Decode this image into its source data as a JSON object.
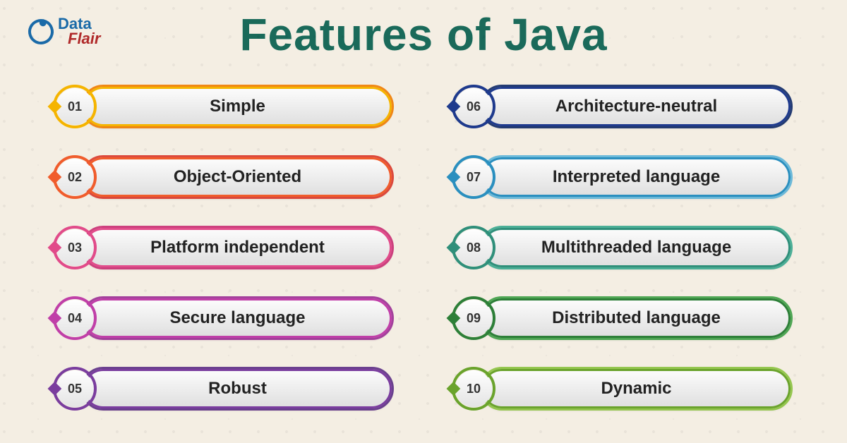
{
  "logo": {
    "line1": "Data",
    "line2": "Flair"
  },
  "title": "Features of Java",
  "features": [
    {
      "num": "01",
      "label": "Simple",
      "color": "c1"
    },
    {
      "num": "02",
      "label": "Object-Oriented",
      "color": "c2"
    },
    {
      "num": "03",
      "label": "Platform independent",
      "color": "c3"
    },
    {
      "num": "04",
      "label": "Secure language",
      "color": "c4"
    },
    {
      "num": "05",
      "label": "Robust",
      "color": "c5"
    },
    {
      "num": "06",
      "label": "Architecture-neutral",
      "color": "c6"
    },
    {
      "num": "07",
      "label": "Interpreted language",
      "color": "c7"
    },
    {
      "num": "08",
      "label": "Multithreaded language",
      "color": "c8"
    },
    {
      "num": "09",
      "label": "Distributed language",
      "color": "c9"
    },
    {
      "num": "10",
      "label": "Dynamic",
      "color": "c10"
    }
  ]
}
